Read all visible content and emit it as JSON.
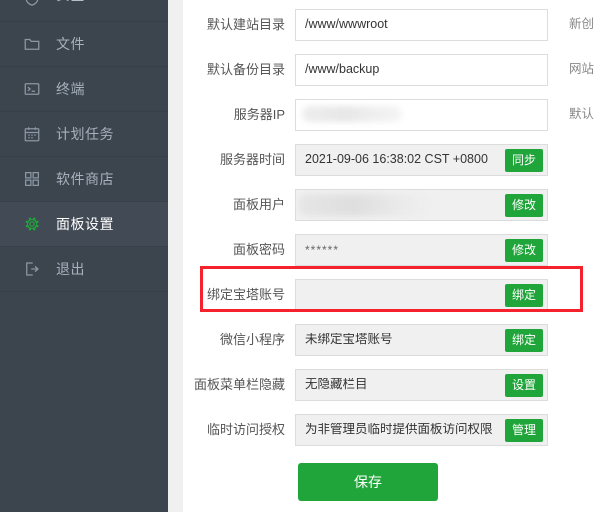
{
  "sidebar": {
    "items": [
      {
        "label": "安全",
        "icon": "shield-icon",
        "active": false,
        "clipped": true
      },
      {
        "label": "文件",
        "icon": "folder-icon",
        "active": false
      },
      {
        "label": "终端",
        "icon": "terminal-icon",
        "active": false
      },
      {
        "label": "计划任务",
        "icon": "calendar-icon",
        "active": false
      },
      {
        "label": "软件商店",
        "icon": "grid-apps-icon",
        "active": false
      },
      {
        "label": "面板设置",
        "icon": "gear-icon",
        "active": true
      },
      {
        "label": "退出",
        "icon": "logout-icon",
        "active": false
      }
    ]
  },
  "form": {
    "rows": [
      {
        "label": "默认建站目录",
        "value": "/www/wwwroot",
        "disabled": false,
        "button": null,
        "hint": "新创"
      },
      {
        "label": "默认备份目录",
        "value": "/www/backup",
        "disabled": false,
        "button": null,
        "hint": "网站"
      },
      {
        "label": "服务器IP",
        "value": "",
        "disabled": false,
        "button": null,
        "hint": "默认",
        "redacted": "ip"
      },
      {
        "label": "服务器时间",
        "value": "2021-09-06 16:38:02 CST +0800",
        "disabled": true,
        "button": "同步",
        "hint": null
      },
      {
        "label": "面板用户",
        "value": "",
        "disabled": true,
        "button": "修改",
        "hint": null,
        "redacted": "user"
      },
      {
        "label": "面板密码",
        "value": "******",
        "disabled": true,
        "button": "修改",
        "hint": null
      },
      {
        "label": "绑定宝塔账号",
        "value": "",
        "disabled": true,
        "button": "绑定",
        "hint": null,
        "highlighted": true
      },
      {
        "label": "微信小程序",
        "value": "未绑定宝塔账号",
        "disabled": true,
        "button": "绑定",
        "hint": null
      },
      {
        "label": "面板菜单栏隐藏",
        "value": "无隐藏栏目",
        "disabled": true,
        "button": "设置",
        "hint": null
      },
      {
        "label": "临时访问授权",
        "value": "为非管理员临时提供面板访问权限",
        "disabled": true,
        "button": "管理",
        "hint": null
      }
    ],
    "save_label": "保存"
  },
  "colors": {
    "sidebar_bg": "#3c444e",
    "sidebar_active_bg": "#424a55",
    "accent_green": "#20a53a",
    "highlight_red": "#f5222d",
    "content_bg": "#ffffff",
    "gap_bg": "#f0f0f0"
  }
}
